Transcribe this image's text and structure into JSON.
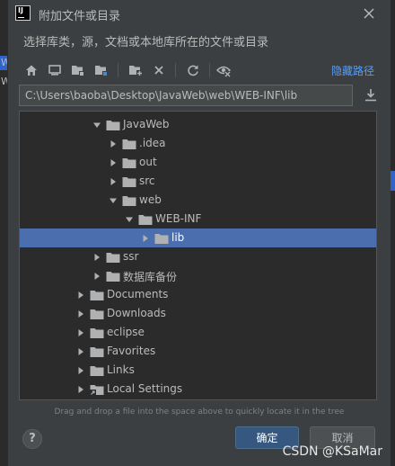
{
  "dialog": {
    "title": "附加文件或目录",
    "description": "选择库类，源，文档或本地库所在的文件或目录",
    "hide_path_label": "隐藏路径",
    "path_value": "C:\\Users\\baoba\\Desktop\\JavaWeb\\web\\WEB-INF\\lib",
    "hint": "Drag and drop a file into the space above to quickly locate it in the tree",
    "ok_label": "确定",
    "cancel_label": "取消",
    "help_label": "?"
  },
  "tree": {
    "rows": [
      {
        "label": "JavaWeb",
        "expanded": true,
        "icon": "folder-icon"
      },
      {
        "label": ".idea",
        "expanded": false,
        "icon": "folder-icon"
      },
      {
        "label": "out",
        "expanded": false,
        "icon": "folder-icon"
      },
      {
        "label": "src",
        "expanded": false,
        "icon": "folder-icon"
      },
      {
        "label": "web",
        "expanded": true,
        "icon": "folder-icon"
      },
      {
        "label": "WEB-INF",
        "expanded": true,
        "icon": "folder-icon"
      },
      {
        "label": "lib",
        "expanded": false,
        "icon": "folder-icon",
        "selected": true
      },
      {
        "label": "ssr",
        "expanded": false,
        "icon": "folder-icon"
      },
      {
        "label": "数据库备份",
        "expanded": false,
        "icon": "folder-icon"
      },
      {
        "label": "Documents",
        "expanded": false,
        "icon": "folder-icon"
      },
      {
        "label": "Downloads",
        "expanded": false,
        "icon": "folder-icon"
      },
      {
        "label": "eclipse",
        "expanded": false,
        "icon": "folder-icon"
      },
      {
        "label": "Favorites",
        "expanded": false,
        "icon": "folder-icon"
      },
      {
        "label": "Links",
        "expanded": false,
        "icon": "folder-icon"
      },
      {
        "label": "Local Settings",
        "expanded": false,
        "icon": "folder-link-icon"
      }
    ]
  },
  "toolbar": {
    "icons": [
      "home-icon",
      "desktop-icon",
      "project-icon",
      "module-icon",
      "new-folder-icon",
      "delete-icon",
      "refresh-icon",
      "show-hidden-icon"
    ]
  },
  "ide_edge": {
    "left_labels": [
      "W",
      "W"
    ]
  },
  "watermark": "CSDN @KSaMar",
  "colors": {
    "selection": "#4b6eaf",
    "link": "#589df6",
    "primary_button": "#365880"
  }
}
